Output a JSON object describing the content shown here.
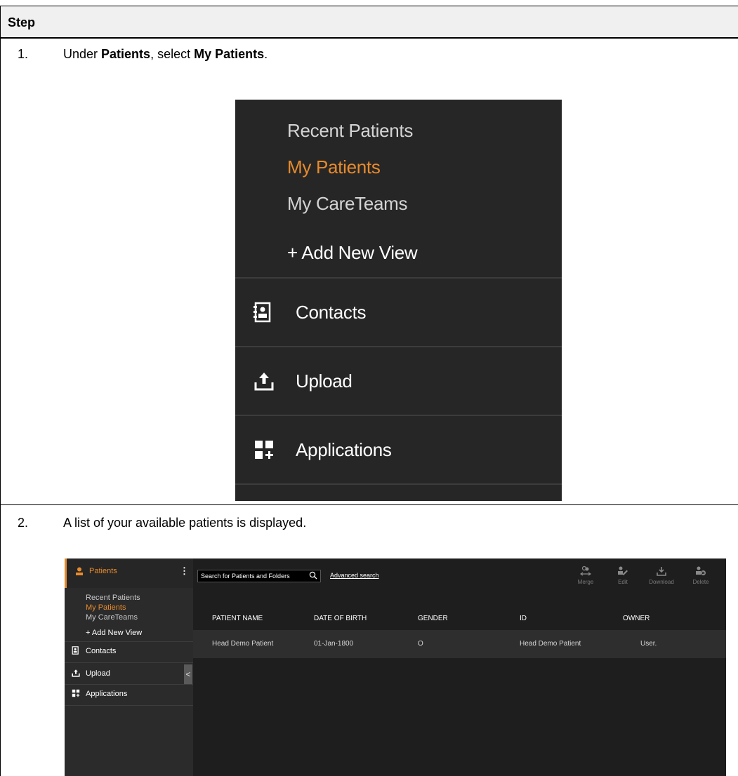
{
  "table": {
    "header": "Step"
  },
  "steps": [
    {
      "number": "1.",
      "text_parts": [
        "Under ",
        "Patients",
        ", select ",
        "My Patients",
        "."
      ]
    },
    {
      "number": "2.",
      "text": "A list of your available patients is displayed."
    }
  ],
  "menu_zoom": {
    "views": [
      {
        "label": "Recent Patients",
        "active": false
      },
      {
        "label": "My Patients",
        "active": true
      },
      {
        "label": "My CareTeams",
        "active": false
      }
    ],
    "add_view": "+ Add New View",
    "sections": [
      {
        "label": "Contacts",
        "icon": "contacts-book-icon"
      },
      {
        "label": "Upload",
        "icon": "upload-icon"
      },
      {
        "label": "Applications",
        "icon": "applications-grid-icon"
      }
    ],
    "colors": {
      "background": "#262626",
      "active": "#e88b2c",
      "text": "#d4d4d4"
    }
  },
  "app": {
    "sidebar": {
      "patients_label": "Patients",
      "views": [
        "Recent Patients",
        "My Patients",
        "My CareTeams"
      ],
      "active_view": "My Patients",
      "add_view": "+ Add New View",
      "sections": [
        "Contacts",
        "Upload",
        "Applications"
      ],
      "collapse_glyph": "<"
    },
    "search": {
      "placeholder": "Search for Patients and Folders"
    },
    "advanced_search": "Advanced search",
    "toolbar": [
      "Merge",
      "Edit",
      "Download",
      "Delete"
    ],
    "columns": [
      "PATIENT NAME",
      "DATE OF BIRTH",
      "GENDER",
      "ID",
      "OWNER"
    ],
    "rows": [
      {
        "name": "Head Demo Patient",
        "dob": "01-Jan-1800",
        "gender": "O",
        "id": "Head Demo Patient",
        "owner": "User."
      }
    ],
    "colors": {
      "accent": "#e88b2c",
      "background": "#1e1e1e",
      "sidebar": "#2b2b2b"
    }
  }
}
